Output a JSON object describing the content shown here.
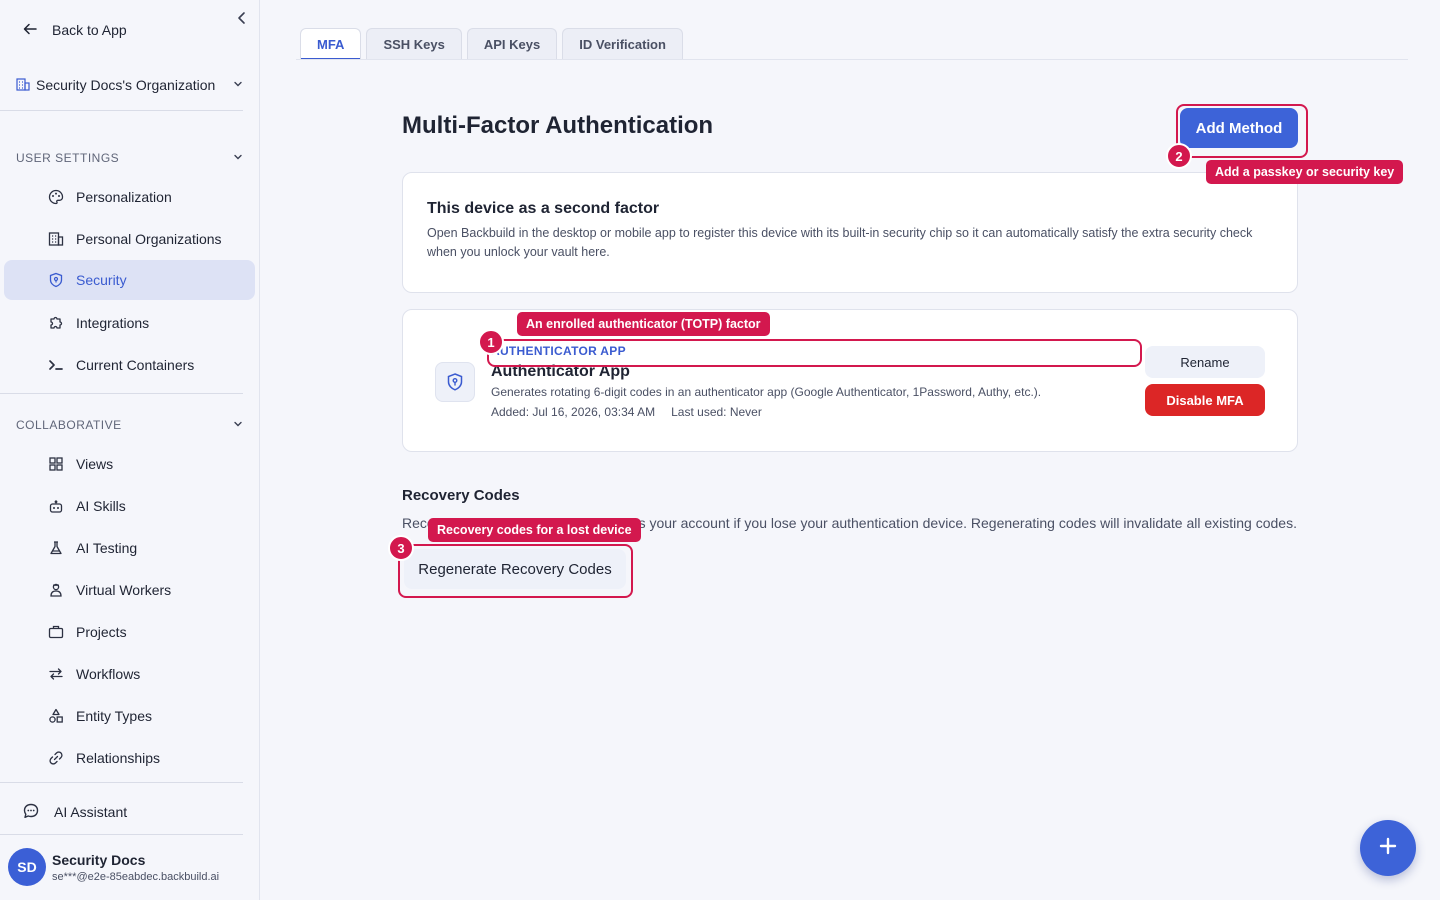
{
  "sidebar": {
    "back_label": "Back to App",
    "org_name": "Security Docs's Organization",
    "user_settings": {
      "heading": "USER SETTINGS",
      "items": [
        {
          "label": "Personalization",
          "icon": "palette-icon"
        },
        {
          "label": "Personal Organizations",
          "icon": "building-icon"
        },
        {
          "label": "Security",
          "icon": "shield-icon"
        },
        {
          "label": "Integrations",
          "icon": "puzzle-icon"
        },
        {
          "label": "Current Containers",
          "icon": "terminal-icon"
        }
      ]
    },
    "collaborative": {
      "heading": "COLLABORATIVE",
      "items": [
        {
          "label": "Views",
          "icon": "grid-icon"
        },
        {
          "label": "AI Skills",
          "icon": "robot-icon"
        },
        {
          "label": "AI Testing",
          "icon": "flask-icon"
        },
        {
          "label": "Virtual Workers",
          "icon": "worker-icon"
        },
        {
          "label": "Projects",
          "icon": "briefcase-icon"
        },
        {
          "label": "Workflows",
          "icon": "arrows-icon"
        },
        {
          "label": "Entity Types",
          "icon": "shapes-icon"
        },
        {
          "label": "Relationships",
          "icon": "link-icon"
        }
      ]
    },
    "assistant_label": "AI Assistant",
    "user": {
      "initials": "SD",
      "name": "Security Docs",
      "email": "se***@e2e-85eabdec.backbuild.ai"
    }
  },
  "tabs": [
    "MFA",
    "SSH Keys",
    "API Keys",
    "ID Verification"
  ],
  "main": {
    "title": "Multi-Factor Authentication",
    "add_method_label": "Add Method",
    "device_card": {
      "title": "This device as a second factor",
      "description": "Open Backbuild in the desktop or mobile app to register this device with its built-in security chip so it can automatically satisfy the extra security check when you unlock your vault here."
    },
    "factor": {
      "type": "AUTHENTICATOR APP",
      "name": "Authenticator App",
      "description": "Generates rotating 6-digit codes in an authenticator app (Google Authenticator, 1Password, Authy, etc.).",
      "added": "Added: Jul 16, 2026, 03:34 AM",
      "last_used": "Last used: Never",
      "rename_label": "Rename",
      "disable_label": "Disable MFA"
    },
    "recovery": {
      "title": "Recovery Codes",
      "description": "Recovery codes can be used to access your account if you lose your authentication device. Regenerating codes will invalidate all existing codes.",
      "button_label": "Regenerate Recovery Codes"
    }
  },
  "annotations": [
    {
      "number": "1",
      "label": "An enrolled authenticator (TOTP) factor"
    },
    {
      "number": "2",
      "label": "Add a passkey or security key"
    },
    {
      "number": "3",
      "label": "Recovery codes for a lost device"
    }
  ],
  "colors": {
    "accent": "#3d63d8",
    "danger": "#dc2626",
    "annotation": "#d3184e"
  }
}
